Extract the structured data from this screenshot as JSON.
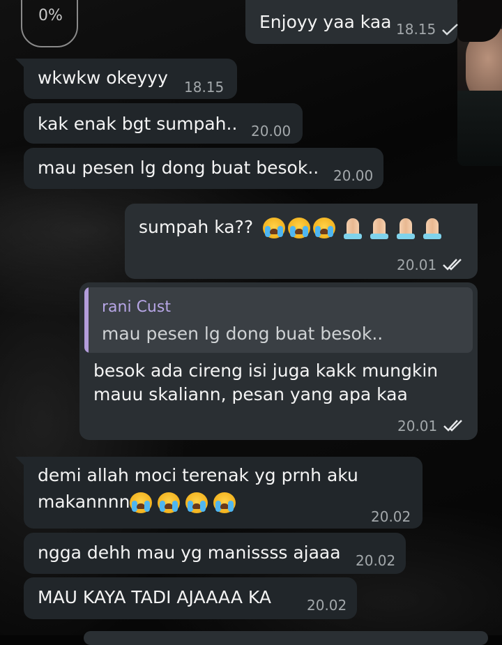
{
  "progress": {
    "label": "0%"
  },
  "messages": [
    {
      "id": "m1",
      "dir": "out",
      "text": "Enjoyy yaa kaa",
      "time": "18.15",
      "status": "sent"
    },
    {
      "id": "m2",
      "dir": "in",
      "text": "wkwkw okeyyy",
      "time": "18.15"
    },
    {
      "id": "m3",
      "dir": "in",
      "text": "kak enak bgt sumpah..",
      "time": "20.00"
    },
    {
      "id": "m4",
      "dir": "in",
      "text": "mau pesen lg dong buat besok..",
      "time": "20.00"
    },
    {
      "id": "m5",
      "dir": "out",
      "text": "sumpah ka??",
      "emoji_cry": 3,
      "emoji_pray": 4,
      "time": "20.01",
      "status": "read"
    },
    {
      "id": "m6",
      "dir": "out",
      "reply": {
        "name": "rani Cust",
        "text": "mau pesen lg dong buat besok.."
      },
      "lines": [
        "besok ada cireng isi juga kakk mungkin",
        "mauu skaliann, pesan yang apa kaa"
      ],
      "time": "20.01",
      "status": "read"
    },
    {
      "id": "m7",
      "dir": "in",
      "lines": [
        "demi allah moci terenak yg prnh aku",
        "makannnn"
      ],
      "emoji_cry": 4,
      "time": "20.02"
    },
    {
      "id": "m8",
      "dir": "in",
      "text": "ngga dehh mau yg manissss ajaaa",
      "time": "20.02"
    },
    {
      "id": "m9",
      "dir": "in",
      "text": "MAU KAYA TADI AJAAAA KA",
      "time": "20.02"
    }
  ],
  "colors": {
    "bubble_in": "#21262a",
    "bubble_out": "#2a2f33",
    "reply_accent": "#b39ddb",
    "time": "#a3a8ab"
  },
  "icons": {
    "sent": "single-check-icon",
    "read": "double-check-icon",
    "cry": "loudly-crying-face-emoji",
    "pray": "folded-hands-emoji"
  }
}
